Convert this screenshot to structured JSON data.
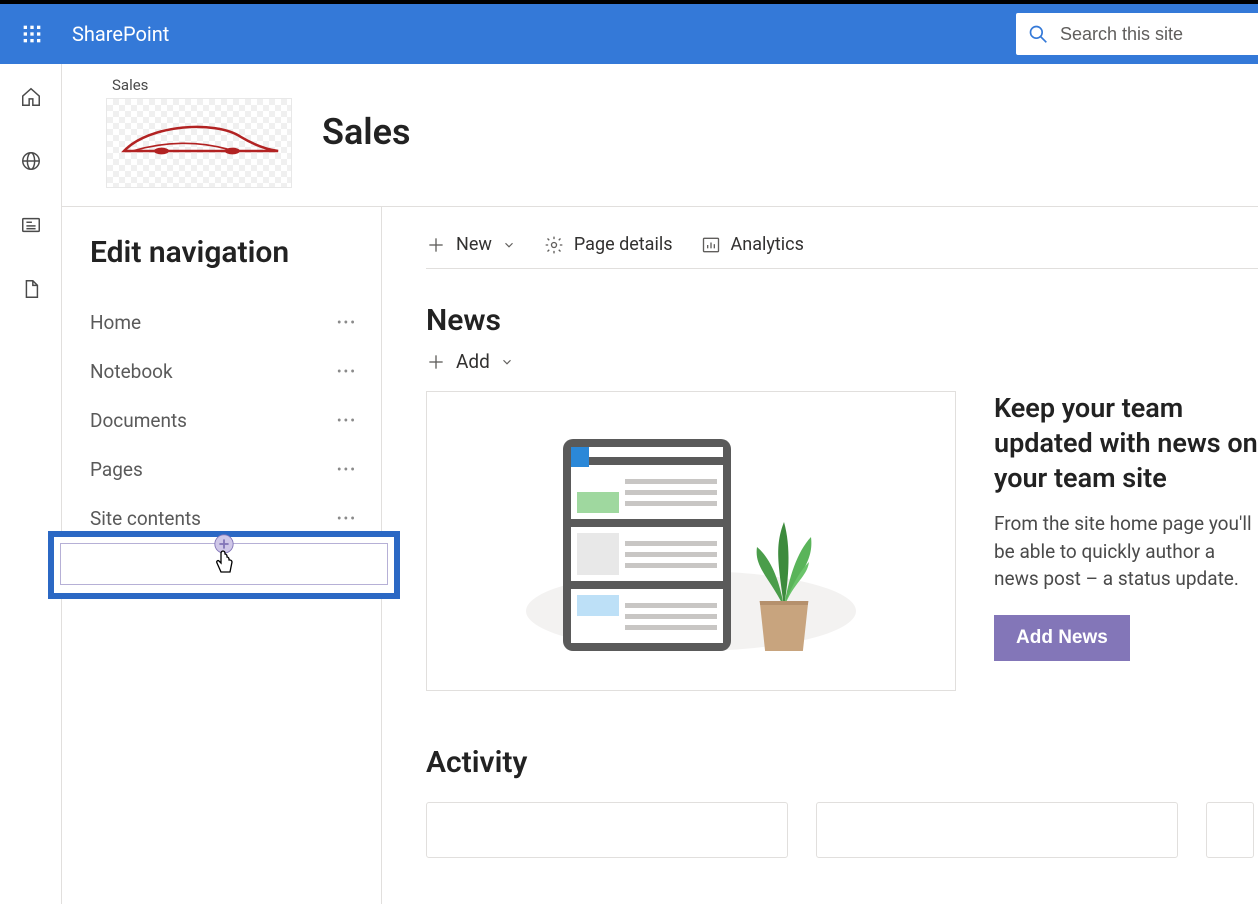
{
  "header": {
    "brand": "SharePoint",
    "search_placeholder": "Search this site"
  },
  "site": {
    "breadcrumb": "Sales",
    "title": "Sales"
  },
  "leftnav": {
    "heading": "Edit navigation",
    "items": [
      {
        "label": "Home"
      },
      {
        "label": "Notebook"
      },
      {
        "label": "Documents"
      },
      {
        "label": "Pages"
      },
      {
        "label": "Site contents"
      }
    ]
  },
  "commandbar": {
    "new": "New",
    "page_details": "Page details",
    "analytics": "Analytics"
  },
  "news": {
    "section_title": "News",
    "add_label": "Add",
    "promo_title": "Keep your team updated with news on your team site",
    "promo_body": "From the site home page you'll be able to quickly author a news post – a status update.",
    "button": "Add News"
  },
  "activity": {
    "section_title": "Activity"
  },
  "colors": {
    "brand_blue": "#3479d8",
    "accent_purple": "#8376b8",
    "highlight_border": "#2b68c4"
  }
}
